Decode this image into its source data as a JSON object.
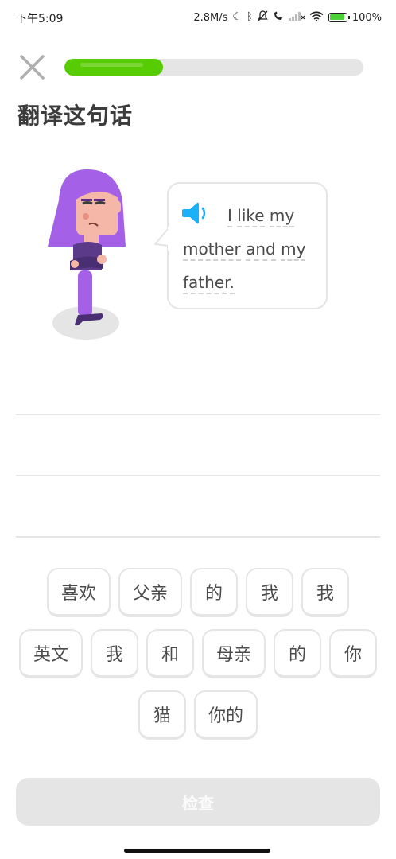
{
  "status_bar": {
    "time": "下午5:09",
    "network_speed": "2.8M/s",
    "battery": "100%",
    "icons": [
      "moon-icon",
      "bluetooth-icon",
      "mute-icon",
      "call-icon",
      "signal-icon",
      "wifi-icon",
      "battery-icon"
    ]
  },
  "progress": {
    "fraction": 0.33
  },
  "title": "翻译这句话",
  "sentence": {
    "words": [
      "I",
      "like",
      "my",
      "mother",
      "and",
      "my",
      "father."
    ]
  },
  "word_bank": {
    "rows": [
      [
        "喜欢",
        "父亲",
        "的",
        "我",
        "我"
      ],
      [
        "英文",
        "我",
        "和",
        "母亲",
        "的",
        "你"
      ],
      [
        "猫",
        "你的"
      ]
    ]
  },
  "check_button": {
    "label": "检查"
  },
  "colors": {
    "progress": "#58cc02",
    "accent_blue": "#1cb0f6",
    "character_hair": "#9b59d0",
    "border": "#e5e5e5"
  }
}
